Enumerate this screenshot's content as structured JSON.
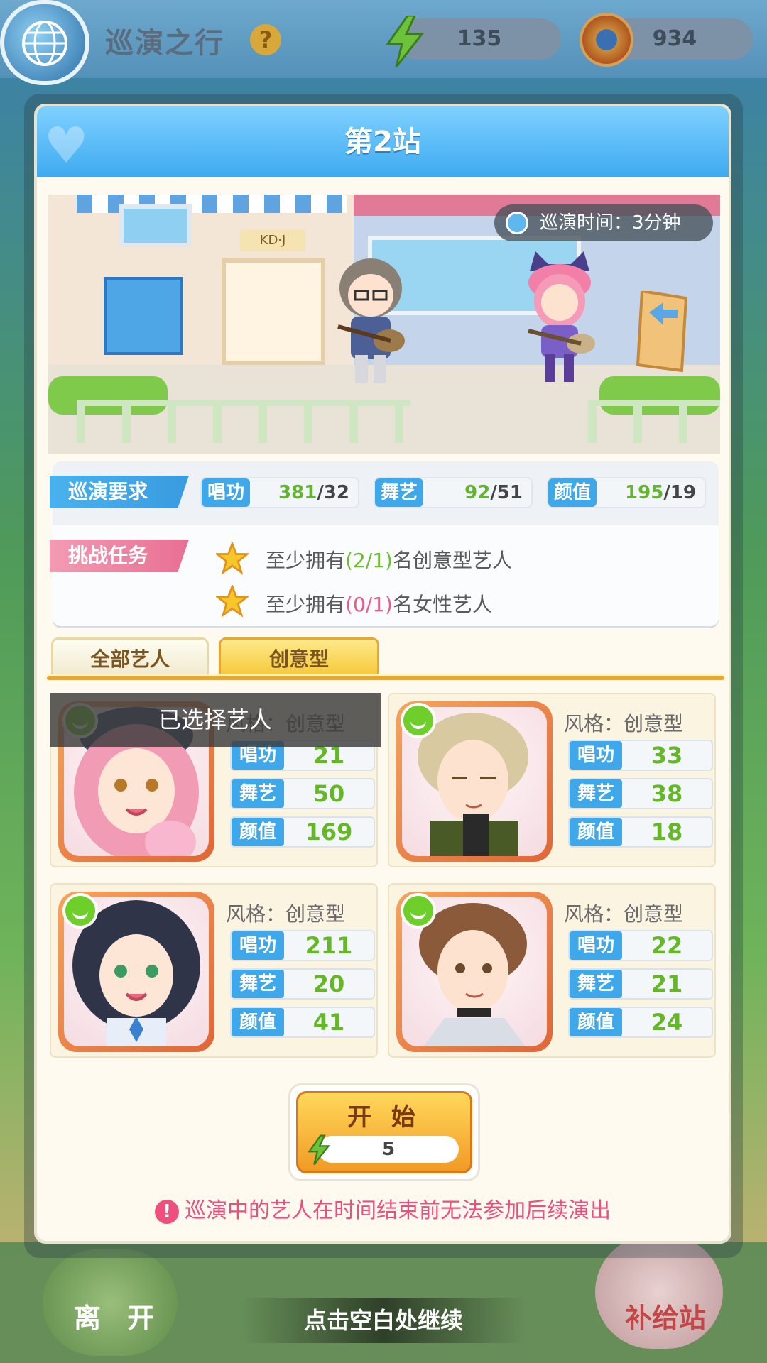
{
  "topbar": {
    "title": "巡演之行",
    "help_symbol": "?",
    "energy": "135",
    "coins": "934"
  },
  "modal": {
    "title": "第2站",
    "tour_time": "巡演时间：3分钟",
    "scene_sign": "KD·J",
    "requirements": {
      "label": "巡演要求",
      "stats": [
        {
          "name": "唱功",
          "current": "381",
          "required": "/32"
        },
        {
          "name": "舞艺",
          "current": "92",
          "required": "/51"
        },
        {
          "name": "颜值",
          "current": "195",
          "required": "/19"
        }
      ]
    },
    "challenge": {
      "label": "挑战任务",
      "tasks": [
        {
          "prefix": "至少拥有",
          "count": "(2/1)",
          "suffix": "名创意型艺人",
          "met": true
        },
        {
          "prefix": "至少拥有",
          "count": "(0/1)",
          "suffix": "名女性艺人",
          "met": false
        }
      ]
    },
    "tabs": [
      "全部艺人",
      "创意型"
    ],
    "selected_tab": "创意型",
    "selected_overlay": "已选择艺人",
    "artists": [
      {
        "style": "风格：创意型",
        "stats": [
          {
            "name": "唱功",
            "value": "21"
          },
          {
            "name": "舞艺",
            "value": "50"
          },
          {
            "name": "颜值",
            "value": "169"
          }
        ]
      },
      {
        "style": "风格：创意型",
        "stats": [
          {
            "name": "唱功",
            "value": "33"
          },
          {
            "name": "舞艺",
            "value": "38"
          },
          {
            "name": "颜值",
            "value": "18"
          }
        ]
      },
      {
        "style": "风格：创意型",
        "stats": [
          {
            "name": "唱功",
            "value": "211"
          },
          {
            "name": "舞艺",
            "value": "20"
          },
          {
            "name": "颜值",
            "value": "41"
          }
        ]
      },
      {
        "style": "风格：创意型",
        "stats": [
          {
            "name": "唱功",
            "value": "22"
          },
          {
            "name": "舞艺",
            "value": "21"
          },
          {
            "name": "颜值",
            "value": "24"
          }
        ]
      }
    ],
    "start": {
      "label": "开 始",
      "cost": "5"
    },
    "warning": "巡演中的艺人在时间结束前无法参加后续演出",
    "warning_symbol": "!"
  },
  "bottom": {
    "leave": "离 开",
    "supply": "补给站",
    "continue_hint": "点击空白处继续"
  },
  "colors": {
    "accent_blue": "#3fa8ea",
    "accent_pink": "#ee4f7f",
    "value_green": "#64b828",
    "button_orange": "#f19a24"
  }
}
